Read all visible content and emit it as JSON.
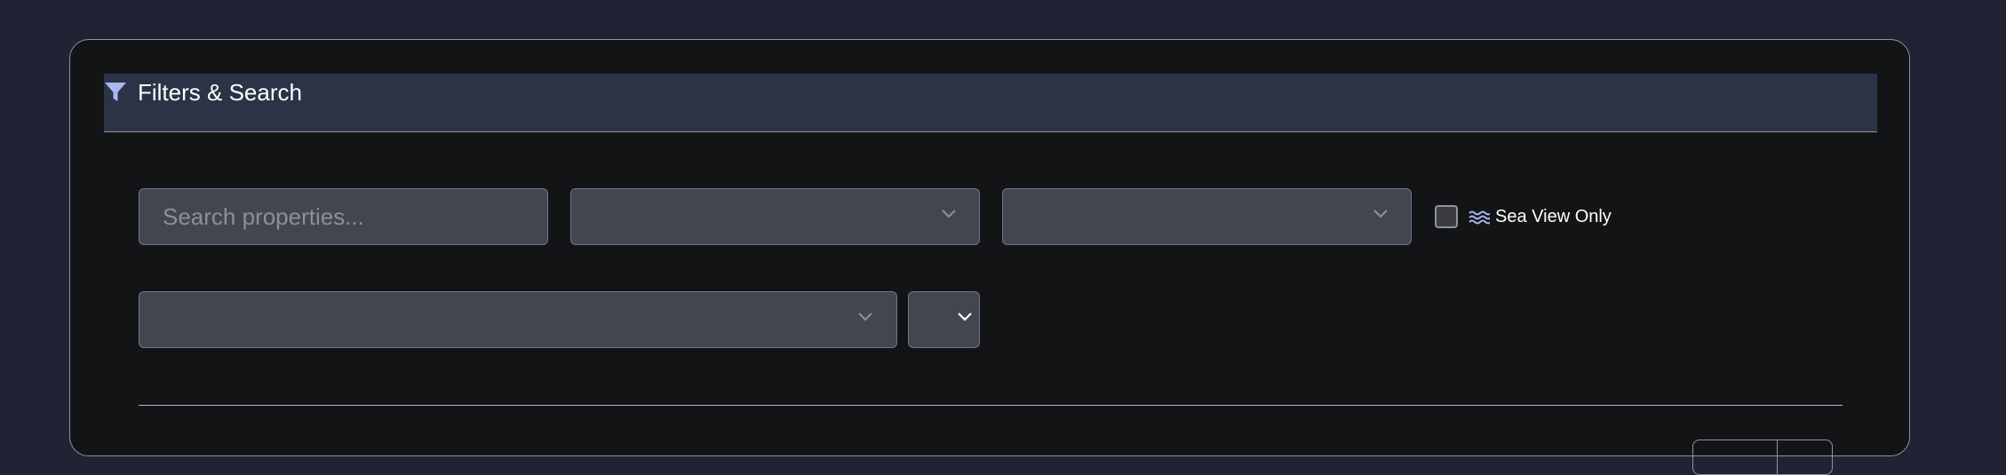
{
  "filters": {
    "title": "Filters & Search",
    "icons": {
      "header": "funnel-icon",
      "sea_view": "waves-icon",
      "dropdown": "chevron-down-icon"
    },
    "search": {
      "placeholder": "Search properties...",
      "value": ""
    },
    "selects": {
      "first": "",
      "second": "",
      "third": "",
      "fourth": ""
    },
    "sea_view": {
      "label": "Sea View Only",
      "checked": false
    }
  },
  "colors": {
    "page_background": "#1f2333",
    "card_background": "#131416",
    "header_background": "#2d3347",
    "field_background": "#43464f",
    "accent": "#a9b8f0"
  }
}
